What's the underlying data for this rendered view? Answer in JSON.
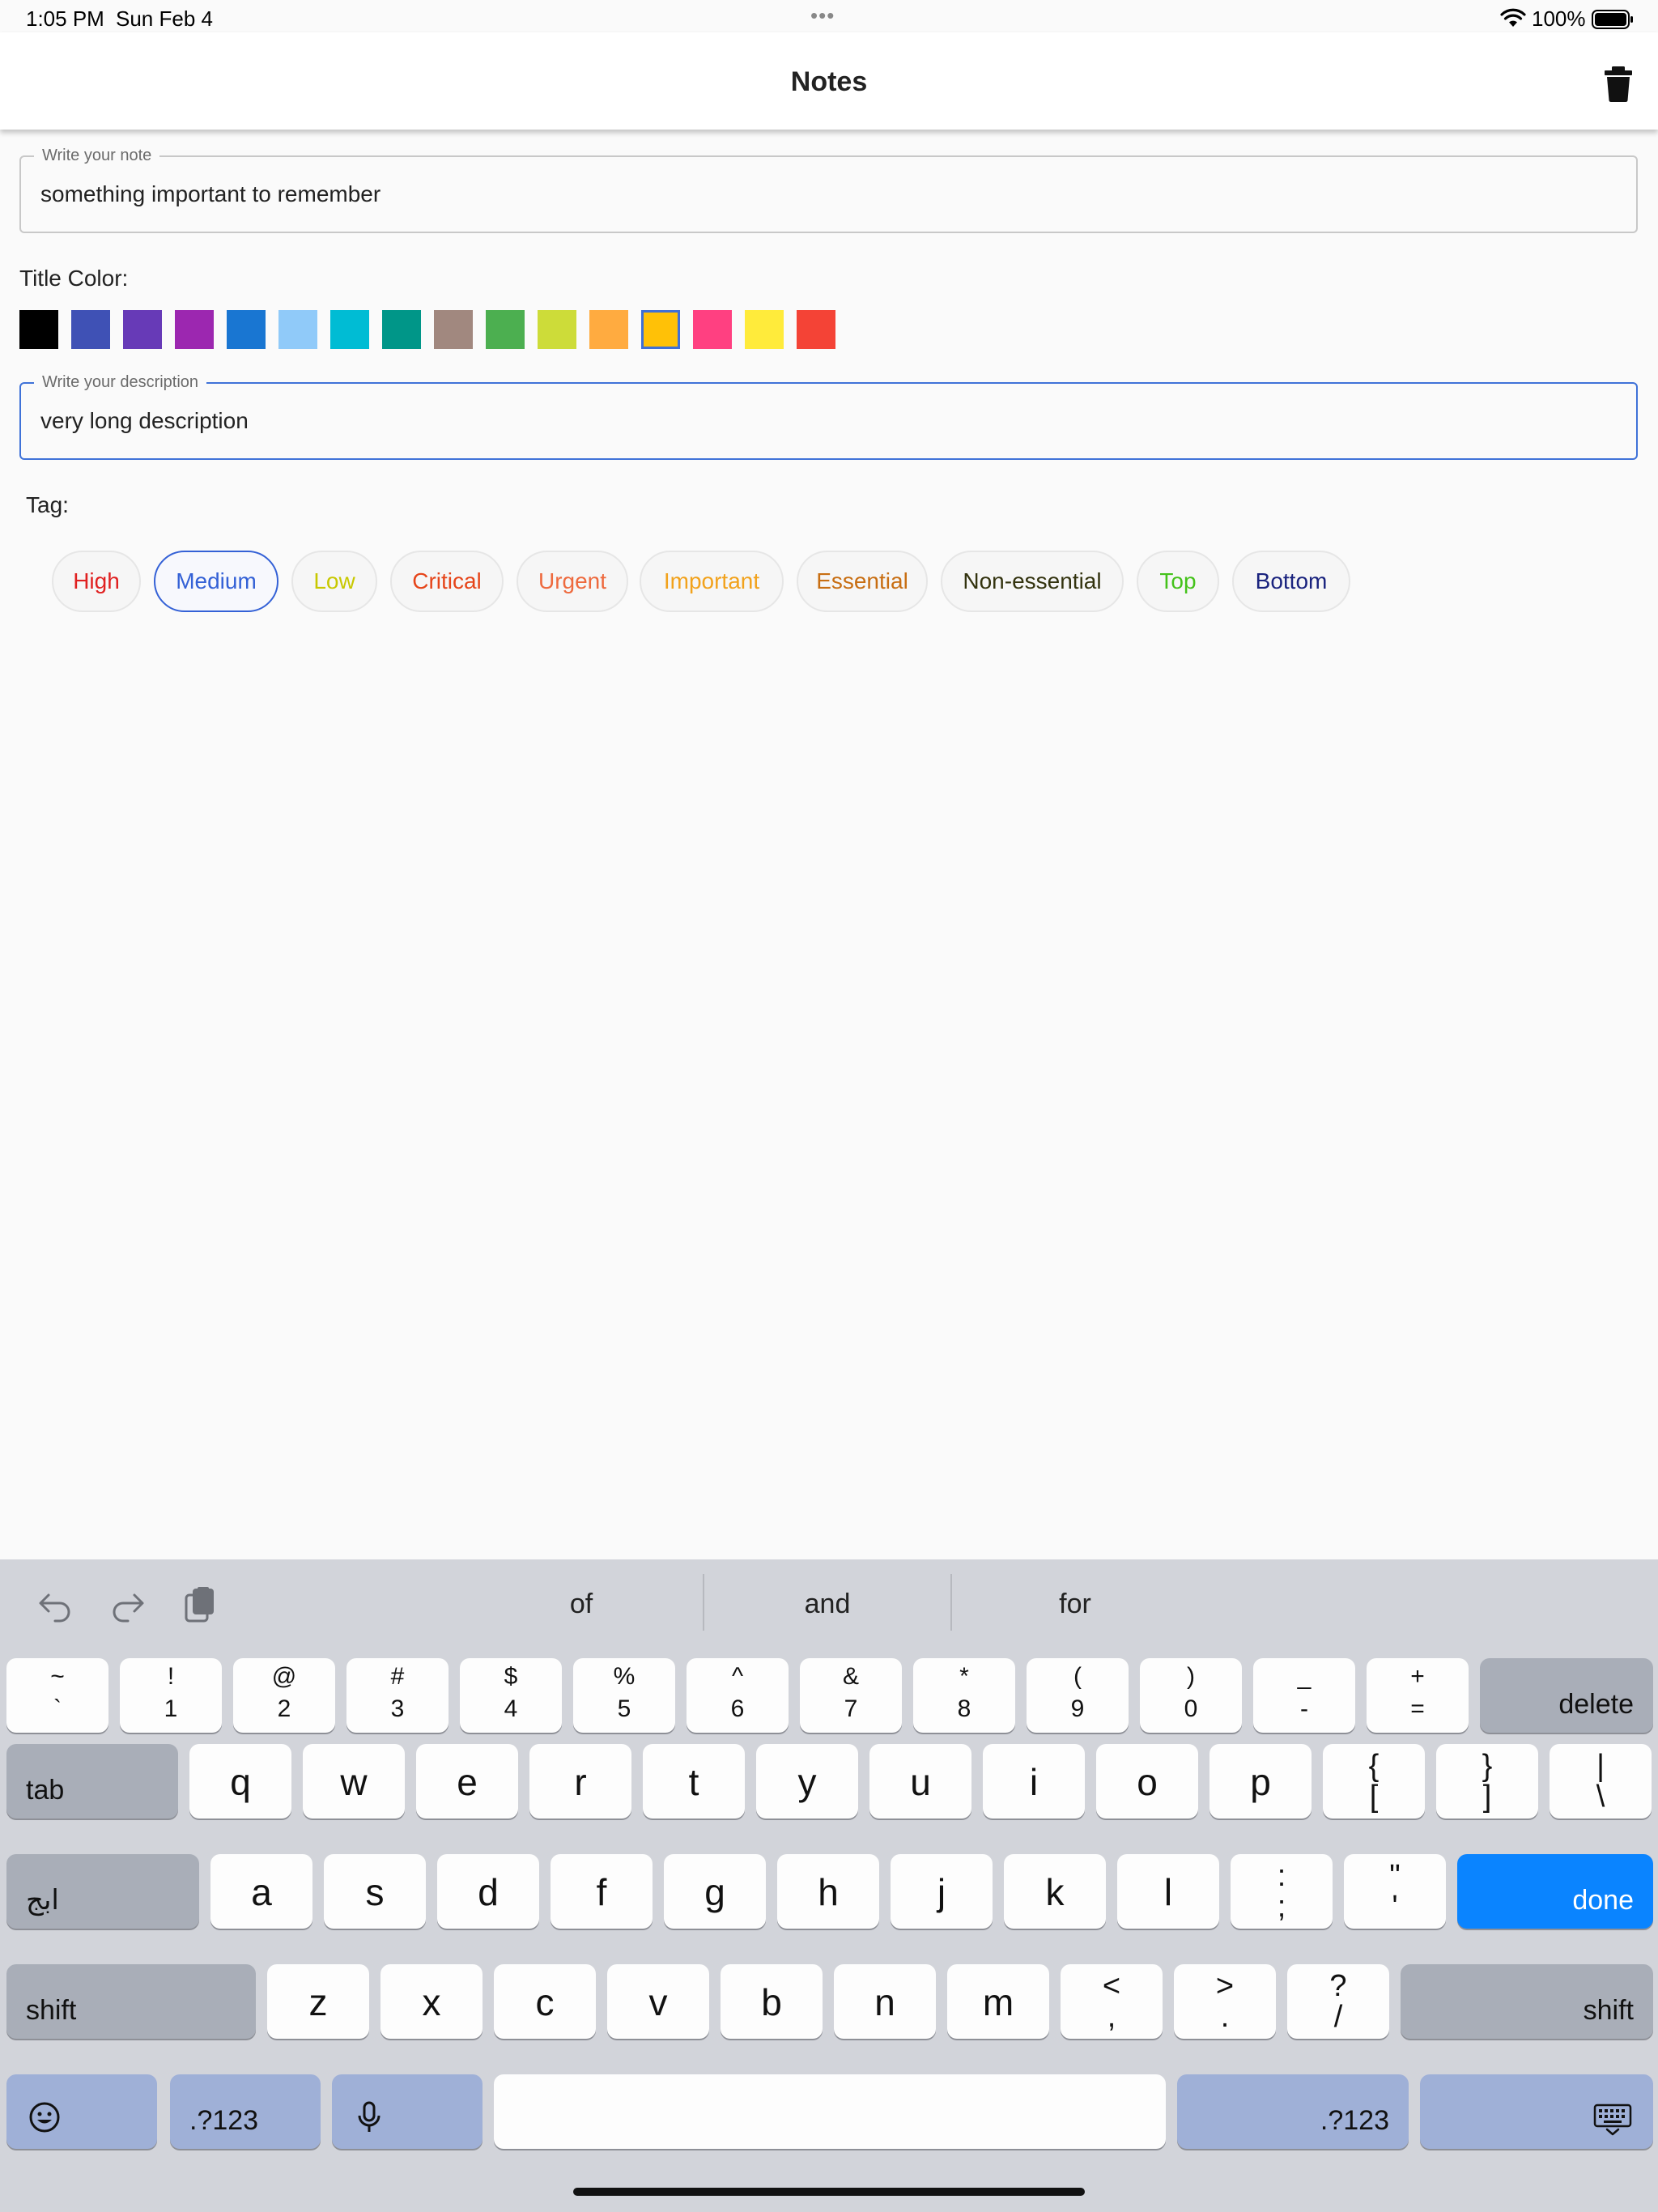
{
  "status_bar": {
    "time": "1:05 PM",
    "date": "Sun Feb 4",
    "dots": "•••",
    "battery": "100%"
  },
  "app_bar": {
    "title": "Notes",
    "trash_icon": "trash-icon"
  },
  "note_field": {
    "label": "Write your note",
    "value": "something important to remember"
  },
  "title_color": {
    "label": "Title Color:",
    "swatches": [
      "#000000",
      "#3f51b5",
      "#673ab7",
      "#9c27b0",
      "#1976d2",
      "#90caf9",
      "#00bcd4",
      "#009688",
      "#a1887f",
      "#4caf50",
      "#cddc39",
      "#ffab40",
      "#ffc107",
      "#ff4081",
      "#ffeb3b",
      "#f44336"
    ],
    "selected_index": 12
  },
  "description_field": {
    "label": "Write your description",
    "value": "very long description"
  },
  "tags": {
    "label": "Tag:",
    "items": [
      {
        "label": "High",
        "color": "#e02020"
      },
      {
        "label": "Medium",
        "color": "#3461d6"
      },
      {
        "label": "Low",
        "color": "#c8c800"
      },
      {
        "label": "Critical",
        "color": "#e6451a"
      },
      {
        "label": "Urgent",
        "color": "#ee6a3e"
      },
      {
        "label": "Important",
        "color": "#f2a21c"
      },
      {
        "label": "Essential",
        "color": "#c86e12"
      },
      {
        "label": "Non-essential",
        "color": "#33330f"
      },
      {
        "label": "Top",
        "color": "#44c21a"
      },
      {
        "label": "Bottom",
        "color": "#1a237e"
      }
    ],
    "selected_index": 1
  },
  "keyboard": {
    "toolbar": {
      "undo_icon": "undo-icon",
      "redo_icon": "redo-icon",
      "paste_icon": "clipboard-icon",
      "suggestions": [
        "of",
        "and",
        "for"
      ]
    },
    "number_row": [
      {
        "top": "~",
        "bottom": "`"
      },
      {
        "top": "!",
        "bottom": "1"
      },
      {
        "top": "@",
        "bottom": "2"
      },
      {
        "top": "#",
        "bottom": "3"
      },
      {
        "top": "$",
        "bottom": "4"
      },
      {
        "top": "%",
        "bottom": "5"
      },
      {
        "top": "^",
        "bottom": "6"
      },
      {
        "top": "&",
        "bottom": "7"
      },
      {
        "top": "*",
        "bottom": "8"
      },
      {
        "top": "(",
        "bottom": "9"
      },
      {
        "top": ")",
        "bottom": "0"
      },
      {
        "top": "_",
        "bottom": "-"
      },
      {
        "top": "+",
        "bottom": "="
      }
    ],
    "delete_label": "delete",
    "tab_label": "tab",
    "qwerty_row": [
      "q",
      "w",
      "e",
      "r",
      "t",
      "y",
      "u",
      "i",
      "o",
      "p"
    ],
    "qwerty_sym": [
      {
        "top": "{",
        "bottom": "["
      },
      {
        "top": "}",
        "bottom": "]"
      },
      {
        "top": "|",
        "bottom": "\\"
      }
    ],
    "language_label": "ابج",
    "asdf_row": [
      "a",
      "s",
      "d",
      "f",
      "g",
      "h",
      "j",
      "k",
      "l"
    ],
    "asdf_sym": [
      {
        "top": ":",
        "bottom": ";"
      },
      {
        "top": "\"",
        "bottom": "'"
      }
    ],
    "done_label": "done",
    "shift_label": "shift",
    "zxcv_row": [
      "z",
      "x",
      "c",
      "v",
      "b",
      "n",
      "m"
    ],
    "zxcv_sym": [
      {
        "top": "<",
        "bottom": ","
      },
      {
        "top": ">",
        "bottom": "."
      },
      {
        "top": "?",
        "bottom": "/"
      }
    ],
    "numbers_label": ".?123",
    "emoji_icon": "emoji-icon",
    "mic_icon": "microphone-icon",
    "dismiss_icon": "keyboard-dismiss-icon"
  }
}
